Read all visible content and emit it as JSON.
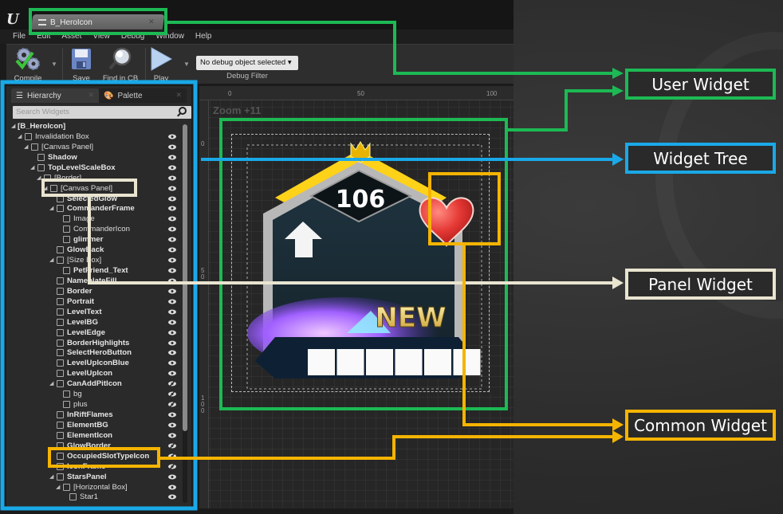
{
  "window": {
    "tab_title": "B_HeroIcon",
    "menu": [
      "File",
      "Edit",
      "Asset",
      "View",
      "Debug",
      "Window",
      "Help"
    ]
  },
  "toolbar": {
    "compile_label": "Compile",
    "save_label": "Save",
    "find_label": "Find in CB",
    "play_label": "Play",
    "debug_select_value": "No debug object selected",
    "debug_filter_label": "Debug Filter"
  },
  "panel": {
    "tabs": [
      {
        "label": "Hierarchy",
        "icon": "list-icon",
        "active": true
      },
      {
        "label": "Palette",
        "icon": "palette-icon",
        "active": false
      }
    ],
    "search_placeholder": "Search Widgets",
    "tree": [
      {
        "label": "[B_HeroIcon]",
        "depth": 0,
        "expanded": true,
        "bold": true,
        "icon": "none",
        "eye": "none"
      },
      {
        "label": "Invalidation Box",
        "depth": 1,
        "expanded": true,
        "bold": false,
        "icon": "invalidation-box-icon",
        "eye": "visible"
      },
      {
        "label": "[Canvas Panel]",
        "depth": 2,
        "expanded": true,
        "bold": false,
        "icon": "canvas-panel-icon",
        "eye": "visible"
      },
      {
        "label": "Shadow",
        "depth": 3,
        "bold": true,
        "icon": "image-icon",
        "eye": "visible"
      },
      {
        "label": "TopLevelScaleBox",
        "depth": 3,
        "expanded": true,
        "bold": true,
        "icon": "scale-box-icon",
        "eye": "visible"
      },
      {
        "label": "[Border]",
        "depth": 4,
        "expanded": true,
        "bold": false,
        "icon": "border-icon",
        "eye": "visible"
      },
      {
        "label": "[Canvas Panel]",
        "depth": 5,
        "expanded": true,
        "bold": false,
        "icon": "canvas-panel-icon",
        "eye": "visible"
      },
      {
        "label": "SelectedGlow",
        "depth": 6,
        "bold": true,
        "icon": "image-icon",
        "eye": "visible"
      },
      {
        "label": "CommanderFrame",
        "depth": 6,
        "expanded": true,
        "bold": true,
        "icon": "canvas-panel-icon",
        "eye": "visible"
      },
      {
        "label": "Image",
        "depth": 7,
        "bold": false,
        "icon": "image-icon",
        "eye": "visible"
      },
      {
        "label": "CommanderIcon",
        "depth": 7,
        "bold": false,
        "icon": "image-icon",
        "eye": "visible"
      },
      {
        "label": "glimmer",
        "depth": 7,
        "bold": true,
        "icon": "image-icon",
        "eye": "visible"
      },
      {
        "label": "GlowBack",
        "depth": 6,
        "bold": true,
        "icon": "image-icon",
        "eye": "visible"
      },
      {
        "label": "[Size Box]",
        "depth": 6,
        "expanded": true,
        "bold": false,
        "icon": "size-box-icon",
        "eye": "visible"
      },
      {
        "label": "PetFriend_Text",
        "depth": 7,
        "bold": true,
        "icon": "text-icon",
        "eye": "visible"
      },
      {
        "label": "NameplateFill",
        "depth": 6,
        "bold": true,
        "icon": "border-icon",
        "eye": "visible"
      },
      {
        "label": "Border",
        "depth": 6,
        "bold": true,
        "icon": "image-icon",
        "eye": "visible"
      },
      {
        "label": "Portrait",
        "depth": 6,
        "bold": true,
        "icon": "image-icon",
        "eye": "visible"
      },
      {
        "label": "LevelText",
        "depth": 6,
        "bold": true,
        "icon": "text-icon",
        "eye": "visible"
      },
      {
        "label": "LevelBG",
        "depth": 6,
        "bold": true,
        "icon": "image-icon",
        "eye": "visible"
      },
      {
        "label": "LevelEdge",
        "depth": 6,
        "bold": true,
        "icon": "image-icon",
        "eye": "visible"
      },
      {
        "label": "BorderHighlights",
        "depth": 6,
        "bold": true,
        "icon": "image-icon",
        "eye": "visible"
      },
      {
        "label": "SelectHeroButton",
        "depth": 6,
        "bold": true,
        "icon": "button-icon",
        "eye": "visible"
      },
      {
        "label": "LevelUpIconBlue",
        "depth": 6,
        "bold": true,
        "icon": "image-icon",
        "eye": "visible"
      },
      {
        "label": "LevelUpIcon",
        "depth": 6,
        "bold": true,
        "icon": "image-icon",
        "eye": "visible"
      },
      {
        "label": "CanAddPitIcon",
        "depth": 6,
        "expanded": true,
        "bold": true,
        "icon": "button-icon",
        "eye": "hidden"
      },
      {
        "label": "bg",
        "depth": 7,
        "bold": false,
        "icon": "image-icon",
        "eye": "hidden"
      },
      {
        "label": "plus",
        "depth": 7,
        "bold": false,
        "icon": "image-icon",
        "eye": "hidden"
      },
      {
        "label": "InRiftFlames",
        "depth": 6,
        "bold": true,
        "icon": "image-icon",
        "eye": "visible"
      },
      {
        "label": "ElementBG",
        "depth": 6,
        "bold": true,
        "icon": "image-icon",
        "eye": "visible"
      },
      {
        "label": "ElementIcon",
        "depth": 6,
        "bold": true,
        "icon": "image-icon",
        "eye": "visible"
      },
      {
        "label": "GlowBorder",
        "depth": 6,
        "bold": true,
        "icon": "image-icon",
        "eye": "hidden"
      },
      {
        "label": "OccupiedSlotTypeIcon",
        "depth": 6,
        "bold": true,
        "icon": "image-icon",
        "eye": "hidden"
      },
      {
        "label": "IconFrame",
        "depth": 6,
        "bold": true,
        "icon": "image-icon",
        "eye": "hidden"
      },
      {
        "label": "StarsPanel",
        "depth": 6,
        "expanded": true,
        "bold": true,
        "icon": "border-icon",
        "eye": "visible"
      },
      {
        "label": "[Horizontal Box]",
        "depth": 7,
        "expanded": true,
        "bold": false,
        "icon": "horizontal-box-icon",
        "eye": "visible"
      },
      {
        "label": "Star1",
        "depth": 8,
        "bold": false,
        "icon": "image-icon",
        "eye": "visible"
      }
    ]
  },
  "designer": {
    "zoom_label": "Zoom +11",
    "ruler_top": [
      "0",
      "50",
      "100"
    ],
    "ruler_left": [
      "0",
      "50",
      "100"
    ],
    "hero_level": "106",
    "new_badge": "NEW",
    "star_slots": 6
  },
  "callouts": {
    "user_widget": {
      "label": "User Widget",
      "color": "#1db954"
    },
    "widget_tree": {
      "label": "Widget Tree",
      "color": "#1aa9e8"
    },
    "panel_widget": {
      "label": "Panel Widget",
      "color": "#e8e4d0"
    },
    "common_widget": {
      "label": "Common Widget",
      "color": "#f5b400"
    }
  }
}
